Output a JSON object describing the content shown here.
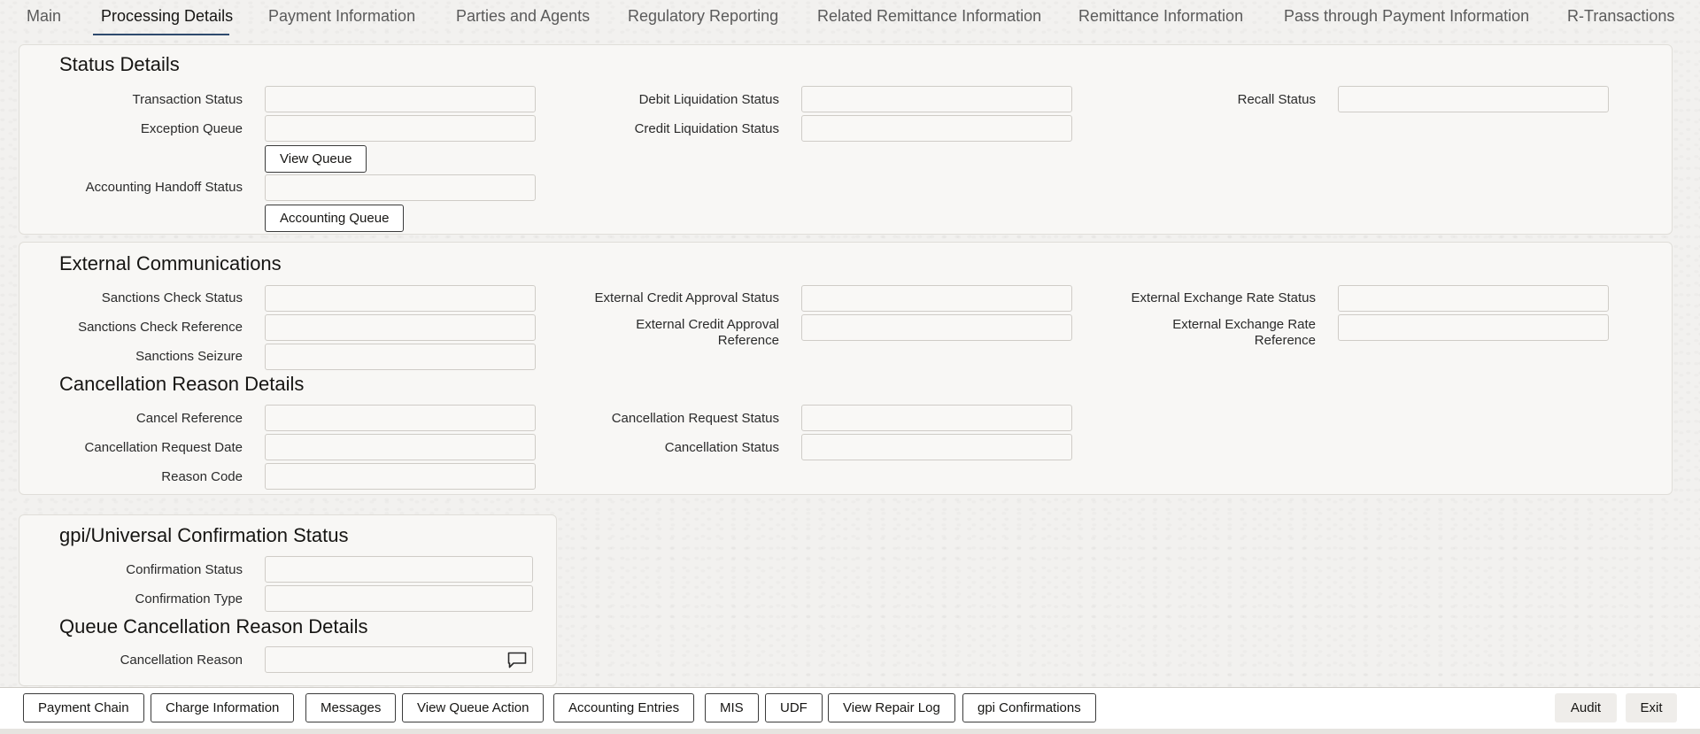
{
  "tabs": [
    "Main",
    "Processing Details",
    "Payment Information",
    "Parties and Agents",
    "Regulatory Reporting",
    "Related Remittance Information",
    "Remittance Information",
    "Pass through Payment Information",
    "R-Transactions"
  ],
  "status": {
    "title": "Status Details",
    "transaction_status": "Transaction Status",
    "exception_queue": "Exception Queue",
    "view_queue": "View Queue",
    "accounting_handoff_status": "Accounting Handoff Status",
    "accounting_queue": "Accounting Queue",
    "debit_liquidation_status": "Debit Liquidation Status",
    "credit_liquidation_status": "Credit Liquidation Status",
    "recall_status": "Recall Status"
  },
  "external": {
    "title": "External Communications",
    "sanctions_check_status": "Sanctions Check Status",
    "sanctions_check_reference": "Sanctions Check Reference",
    "sanctions_seizure": "Sanctions Seizure",
    "ext_credit_approval_status": "External Credit Approval Status",
    "ext_credit_approval_reference_1": "External Credit Approval",
    "ext_credit_approval_reference_2": "Reference",
    "ext_exchange_rate_status": "External Exchange Rate Status",
    "ext_exchange_rate_reference_1": "External Exchange Rate",
    "ext_exchange_rate_reference_2": "Reference"
  },
  "cancellation": {
    "title": "Cancellation Reason Details",
    "cancel_reference": "Cancel Reference",
    "cancellation_request_date": "Cancellation Request Date",
    "reason_code": "Reason Code",
    "cancellation_request_status": "Cancellation Request Status",
    "cancellation_status": "Cancellation Status"
  },
  "gpi": {
    "title": "gpi/Universal Confirmation Status",
    "confirmation_status": "Confirmation Status",
    "confirmation_type": "Confirmation Type"
  },
  "queue_cancel": {
    "title": "Queue Cancellation Reason Details",
    "cancellation_reason": "Cancellation Reason"
  },
  "footer": {
    "buttons": [
      "Payment Chain",
      "Charge Information",
      "Messages",
      "View Queue Action",
      "Accounting Entries",
      "MIS",
      "UDF",
      "View Repair Log",
      "gpi Confirmations"
    ],
    "audit": "Audit",
    "exit": "Exit"
  }
}
